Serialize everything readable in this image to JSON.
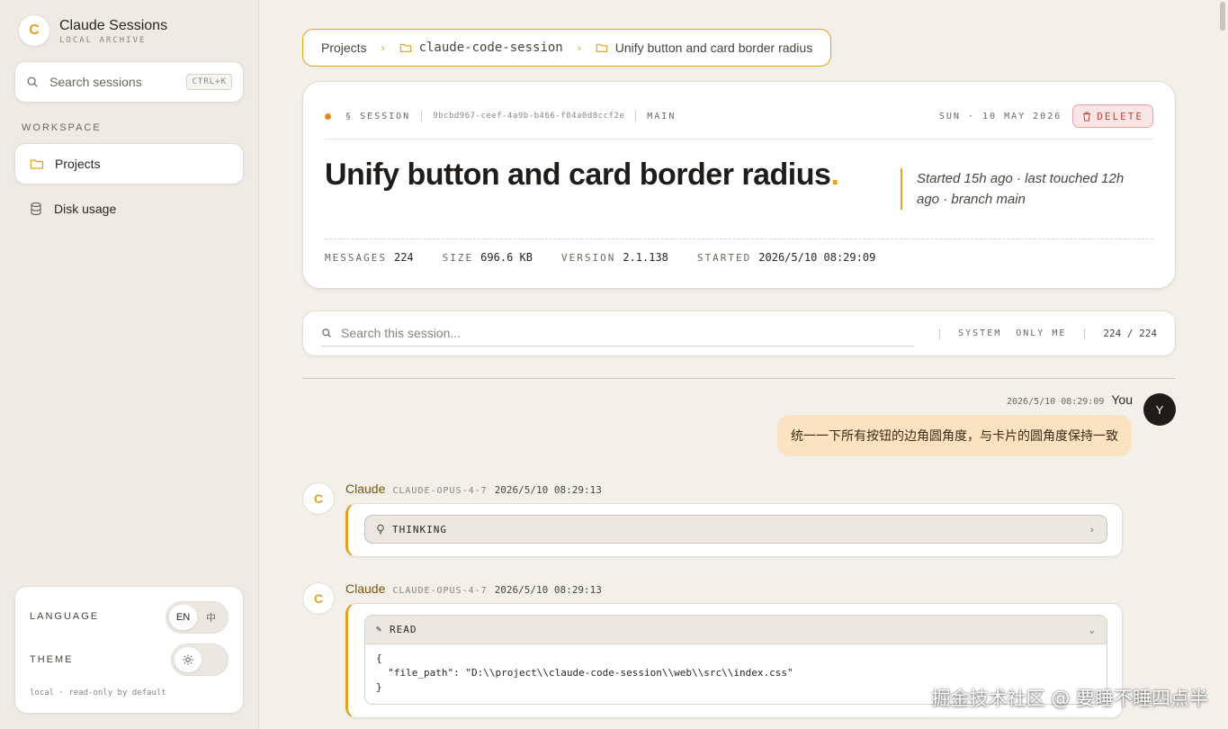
{
  "brand": {
    "title": "Claude Sessions",
    "subtitle": "LOCAL ARCHIVE",
    "logo": "C"
  },
  "sidebar": {
    "search_placeholder": "Search sessions",
    "search_shortcut": "CTRL+K",
    "section_label": "WORKSPACE",
    "items": [
      {
        "label": "Projects",
        "icon": "folder-icon",
        "active": true
      },
      {
        "label": "Disk usage",
        "icon": "database-icon",
        "active": false
      }
    ],
    "settings": {
      "language_label": "LANGUAGE",
      "lang_options": [
        "EN",
        "中"
      ],
      "theme_label": "THEME",
      "footer": "local · read-only by default"
    }
  },
  "breadcrumb": {
    "root": "Projects",
    "project": "claude-code-session",
    "session": "Unify button and card border radius"
  },
  "session": {
    "badge": "§ SESSION",
    "id": "9bcbd967-ceef-4a9b-b466-f04a0d8ccf2e",
    "branch": "MAIN",
    "date": "SUN · 10 MAY 2026",
    "delete_label": "DELETE",
    "title": "Unify button and card border radius",
    "title_accent": ".",
    "aside": "Started 15h ago · last touched 12h ago · branch main",
    "stats": [
      {
        "key": "MESSAGES",
        "value": "224"
      },
      {
        "key": "SIZE",
        "value": "696.6 KB"
      },
      {
        "key": "VERSION",
        "value": "2.1.138"
      },
      {
        "key": "STARTED",
        "value": "2026/5/10 08:29:09"
      }
    ]
  },
  "session_search": {
    "placeholder": "Search this session...",
    "filter_system": "SYSTEM",
    "filter_only_me": "ONLY ME",
    "count": "224 / 224"
  },
  "messages": [
    {
      "role": "user",
      "name": "You",
      "avatar": "Y",
      "timestamp": "2026/5/10 08:29:09",
      "text": "统一一下所有按钮的边角圆角度，与卡片的圆角度保持一致"
    },
    {
      "role": "assistant",
      "name": "Claude",
      "model": "CLAUDE-OPUS-4-7",
      "timestamp": "2026/5/10 08:29:13",
      "block_label": "THINKING"
    },
    {
      "role": "assistant",
      "name": "Claude",
      "model": "CLAUDE-OPUS-4-7",
      "timestamp": "2026/5/10 08:29:13",
      "block_label": "READ",
      "body": "{\n  \"file_path\": \"D:\\\\project\\\\claude-code-session\\\\web\\\\src\\\\index.css\"\n}"
    }
  ],
  "watermark": "掘金技术社区 @ 要睡不睡四点半",
  "colors": {
    "accent": "#e0a21f",
    "danger": "#c9443e",
    "user_bubble": "#fbe3c2",
    "background": "#f3f0ea"
  }
}
